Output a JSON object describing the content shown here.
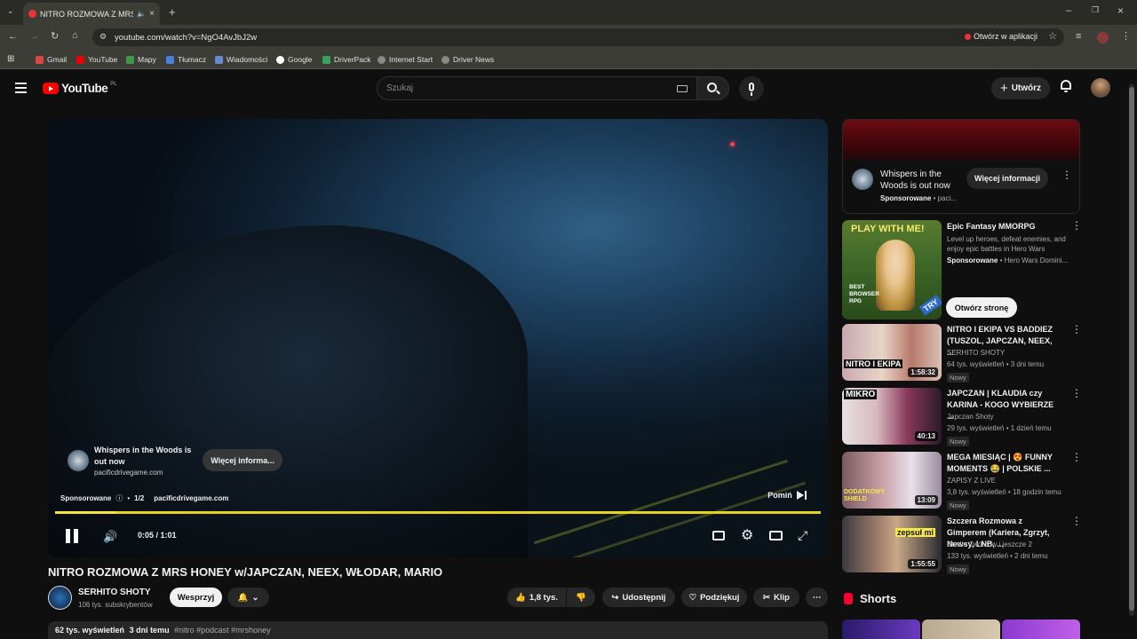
{
  "browser": {
    "tab_title": "NITRO ROZMOWA Z MRS H",
    "url": "youtube.com/watch?v=NgO4AvJbJ2w",
    "open_in_app": "Otwórz w aplikacji",
    "bookmarks": [
      "Gmail",
      "YouTube",
      "Mapy",
      "Tłumacz",
      "Wiadomości",
      "Google",
      "DriverPack",
      "Internet Start",
      "Driver News"
    ]
  },
  "header": {
    "logo": "YouTube",
    "logo_region": "PL",
    "search_placeholder": "Szukaj",
    "create_label": "Utwórz"
  },
  "player": {
    "ad_title": "Whispers in the Woods is out now",
    "ad_domain": "pacificdrivegame.com",
    "ad_more": "Więcej informa...",
    "sponsored": "Sponsorowane",
    "ad_count": "1/2",
    "ad_domain2": "pacificdrivegame.com",
    "skip": "Pomiń",
    "time": "0:05 / 1:01",
    "progress": 0.08
  },
  "video": {
    "title": "NITRO ROZMOWA Z MRS HONEY w/JAPCZAN, NEEX, WŁODAR, MARIO",
    "channel": "SERHITO SHOTY",
    "subscribers": "106 tys. subskrybentów",
    "support": "Wesprzyj",
    "likes": "1,8 tys.",
    "share": "Udostępnij",
    "thanks": "Podziękuj",
    "clip": "Klip",
    "views": "62 tys. wyświetleń",
    "age": "3 dni temu",
    "tags": "#nitro #podcast #mrshoney"
  },
  "sidebar": {
    "ad_top": {
      "title": "Whispers in the Woods is out now",
      "sponsored": "Sponsorowane",
      "domain": "paci...",
      "button": "Więcej informacji"
    },
    "ad_game": {
      "title": "Epic Fantasy MMORPG",
      "desc": "Level up heroes, defeat enemies, and enjoy epic battles in Hero Wars",
      "sponsored": "Sponsorowane",
      "advertiser": "Hero Wars Domini...",
      "button": "Otwórz stronę",
      "thumb_text": "PLAY WITH ME!",
      "thumb_sub": "BEST BROWSER RPG",
      "thumb_try": "TRY"
    },
    "videos": [
      {
        "title": "NITRO I EKIPA VS BADDIEZ (TUSZOL, JAPCZAN, NEEX, ...",
        "channel": "SERHITO SHOTY",
        "meta": "64 tys. wyświetleń • 3 dni temu",
        "badge": "Nowy",
        "duration": "1:58:32",
        "thumb_text": "NITRO I EKIPA"
      },
      {
        "title": "JAPCZAN | KLAUDIA czy KARINA - KOGO WYBIERZE ...",
        "channel": "Japczan Shoty",
        "meta": "29 tys. wyświetleń • 1 dzień temu",
        "badge": "Nowy",
        "duration": "40:13",
        "thumb_text": "MIKRO"
      },
      {
        "title": "MEGA MIESIĄC | 😍 FUNNY MOMENTS 😂 | POLSKIE ...",
        "channel": "ZAPISY Z LIVE",
        "meta": "3,8 tys. wyświetleń • 18 godzin temu",
        "badge": "Nowy",
        "duration": "13:09",
        "thumb_text": "DODATKOWY SHIELD"
      },
      {
        "title": "Szczera Rozmowa z Gimperem (Kariera, Zgrzyt, Newsy, LNB, ...",
        "channel": "Studio Twórców i jeszcze 2",
        "meta": "133 tys. wyświetleń • 2 dni temu",
        "badge": "Nowy",
        "duration": "1:55:55",
        "thumb_text": "zepsuł mi"
      }
    ],
    "shorts_label": "Shorts"
  },
  "colors": {
    "accent": "#ff0000",
    "progress": "#e6d41a",
    "bg": "#0f0f0f"
  }
}
